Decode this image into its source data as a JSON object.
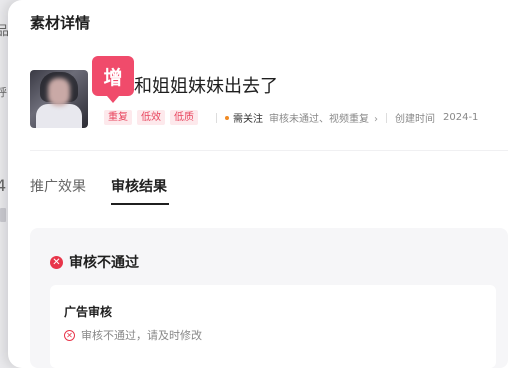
{
  "panel": {
    "title": "素材详情"
  },
  "backdrop": {
    "chars": [
      "品",
      "呼",
      "4"
    ]
  },
  "material": {
    "badge": "增",
    "title": "和姐姐妹妹出去了",
    "tags": [
      "重复",
      "低效",
      "低质"
    ],
    "attention_label": "需关注",
    "attention_detail": "审核未通过、视频重复",
    "chevron": "›",
    "created_label": "创建时间",
    "created_value": "2024-1"
  },
  "tabs": [
    {
      "label": "推广效果"
    },
    {
      "label": "审核结果"
    }
  ],
  "result": {
    "status": "审核不通过",
    "card": {
      "title": "广告审核",
      "message": "审核不通过，请及时修改"
    }
  },
  "colors": {
    "brand_pink": "#f04b6b",
    "error_red": "#e8354a",
    "warning_orange": "#f08a24"
  }
}
